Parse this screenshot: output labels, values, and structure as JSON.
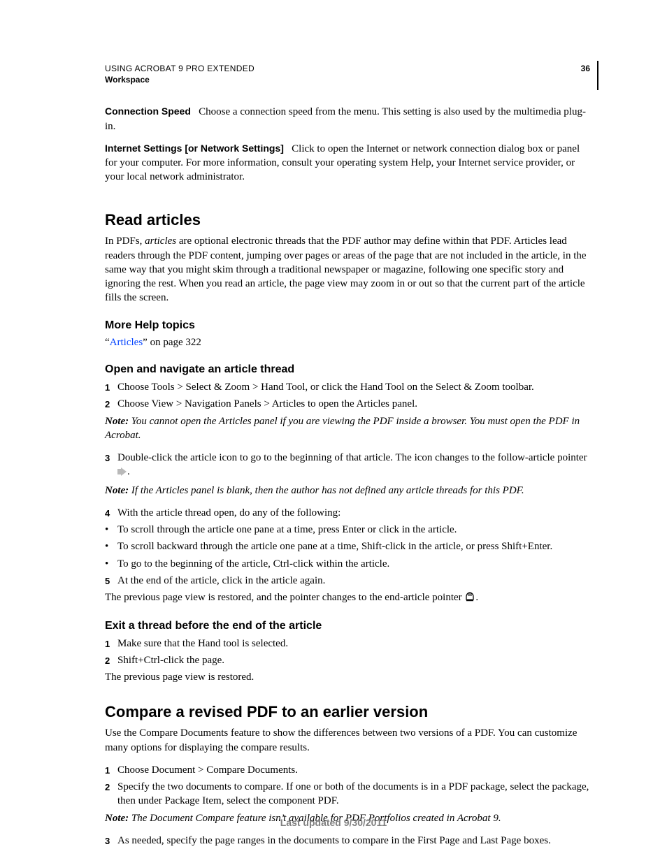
{
  "header": {
    "line1": "USING ACROBAT 9 PRO EXTENDED",
    "line2": "Workspace",
    "page_number": "36"
  },
  "runins": {
    "connection_speed": {
      "label": "Connection Speed",
      "text": "Choose a connection speed from the menu. This setting is also used by the multimedia plug-in."
    },
    "internet_settings": {
      "label": "Internet Settings [or Network Settings]",
      "text": "Click to open the Internet or network connection dialog box or panel for your computer. For more information, consult your operating system Help, your Internet service provider, or your local network administrator."
    }
  },
  "read_articles": {
    "heading": "Read articles",
    "intro_pre": "In PDFs, ",
    "intro_em": "articles",
    "intro_post": " are optional electronic threads that the PDF author may define within that PDF. Articles lead readers through the PDF content, jumping over pages or areas of the page that are not included in the article, in the same way that you might skim through a traditional newspaper or magazine, following one specific story and ignoring the rest. When you read an article, the page view may zoom in or out so that the current part of the article fills the screen.",
    "more_help_heading": "More Help topics",
    "more_help_q1": "“",
    "more_help_link": "Articles",
    "more_help_q2": "” on page 322",
    "open_nav_heading": "Open and navigate an article thread",
    "steps": {
      "s1": "Choose Tools > Select & Zoom > Hand Tool, or click the Hand Tool on the Select & Zoom toolbar.",
      "s2": "Choose View > Navigation Panels > Articles to open the Articles panel.",
      "note1_label": "Note:",
      "note1_body": " You cannot open the Articles panel if you are viewing the PDF inside a browser. You must open the PDF in Acrobat.",
      "s3_pre": "Double-click the article icon to go to the beginning of that article. The icon changes to the follow-article pointer ",
      "s3_post": ".",
      "note2_label": "Note:",
      "note2_body": " If the Articles panel is blank, then the author has not defined any article threads for this PDF.",
      "s4": "With the article thread open, do any of the following:",
      "b1": "To scroll through the article one pane at a time, press Enter or click in the article.",
      "b2": "To scroll backward through the article one pane at a time, Shift-click in the article, or press Shift+Enter.",
      "b3": "To go to the beginning of the article, Ctrl-click within the article.",
      "s5": "At the end of the article, click in the article again.",
      "tail_pre": "The previous page view is restored, and the pointer changes to the end-article pointer ",
      "tail_post": "."
    },
    "exit_heading": "Exit a thread before the end of the article",
    "exit": {
      "s1": "Make sure that the Hand tool is selected.",
      "s2": "Shift+Ctrl-click the page.",
      "tail": "The previous page view is restored."
    }
  },
  "compare": {
    "heading": "Compare a revised PDF to an earlier version",
    "intro": "Use the Compare Documents feature to show the differences between two versions of a PDF. You can customize many options for displaying the compare results.",
    "s1": "Choose Document > Compare Documents.",
    "s2": "Specify the two documents to compare. If one or both of the documents is in a PDF package, select the package, then under Package Item, select the component PDF.",
    "note_label": "Note:",
    "note_body": " The Document Compare feature isn’t available for PDF Portfolios created in Acrobat 9.",
    "s3": "As needed, specify the page ranges in the documents to compare in the First Page and Last Page boxes."
  },
  "footer": "Last updated 9/30/2011",
  "list_markers": {
    "n1": "1",
    "n2": "2",
    "n3": "3",
    "n4": "4",
    "n5": "5",
    "bullet": "•"
  }
}
